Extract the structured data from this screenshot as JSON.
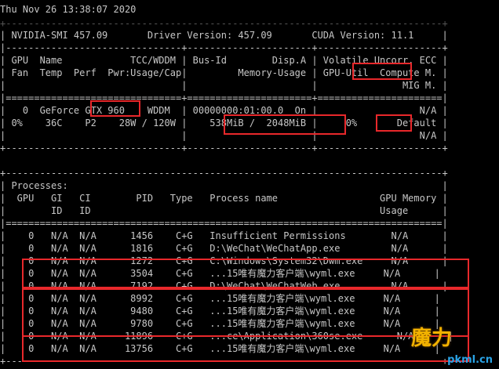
{
  "header": {
    "timestamp": "Thu Nov 26 13:38:07 2020",
    "version_line": "| NVIDIA-SMI 457.09       Driver Version: 457.09       CUDA Version: 11.1     |"
  },
  "gpu_table": {
    "border_top": "|-------------------------------+----------------------+----------------------+",
    "header_row1": "| GPU  Name            TCC/WDDM | Bus-Id        Disp.A | Volatile Uncorr. ECC |",
    "header_row2": "| Fan  Temp  Perf  Pwr:Usage/Cap|         Memory-Usage | GPU-Util  Compute M. |",
    "header_row3": "|                               |                      |               MIG M. |",
    "separator": "|===============================+======================+======================|",
    "row1": "|   0  GeForce GTX 960    WDDM  | 00000000:01:00.0  On |                  N/A |",
    "row2": "| 0%    36C    P2    28W / 120W |    538MiB /  2048MiB |     0%       Default |",
    "row3": "|                               |                      |                  N/A |",
    "border_bottom": "+-------------------------------+----------------------+----------------------+"
  },
  "processes": {
    "border_top": "+-----------------------------------------------------------------------------+",
    "title": "| Processes:                                                                  |",
    "header1": "|  GPU   GI   CI        PID   Type   Process name                  GPU Memory |",
    "header2": "|        ID   ID                                                   Usage      |",
    "separator": "|=============================================================================|",
    "rows": [
      "|    0   N/A  N/A      1456    C+G   Insufficient Permissions        N/A      |",
      "|    0   N/A  N/A      1816    C+G   D:\\WeChat\\WeChatApp.exe         N/A      |",
      "|    0   N/A  N/A      1272    C+G   C:\\Windows\\System32\\Dwm.exe     N/A      |",
      "|    0   N/A  N/A      3504    C+G   ...15唯有魔力客户端\\wyml.exe     N/A      |",
      "|    0   N/A  N/A      7192    C+G   D:\\WeChat\\WeChatWeb.exe         N/A      |",
      "|    0   N/A  N/A      8992    C+G   ...15唯有魔力客户端\\wyml.exe     N/A      |",
      "|    0   N/A  N/A      9480    C+G   ...15唯有魔力客户端\\wyml.exe     N/A      |",
      "|    0   N/A  N/A      9780    C+G   ...15唯有魔力客户端\\wyml.exe     N/A      |",
      "|    0   N/A  N/A     11896    C+G   ...ce\\Application\\360se.exe      N/A      |",
      "|    0   N/A  N/A     13756    C+G   ...15唯有魔力客户端\\wyml.exe     N/A      |"
    ],
    "border_bottom": "+-----------------------------------------------------------------------------+"
  },
  "watermark": {
    "text": "pkml.cn",
    "big": "魔力"
  }
}
